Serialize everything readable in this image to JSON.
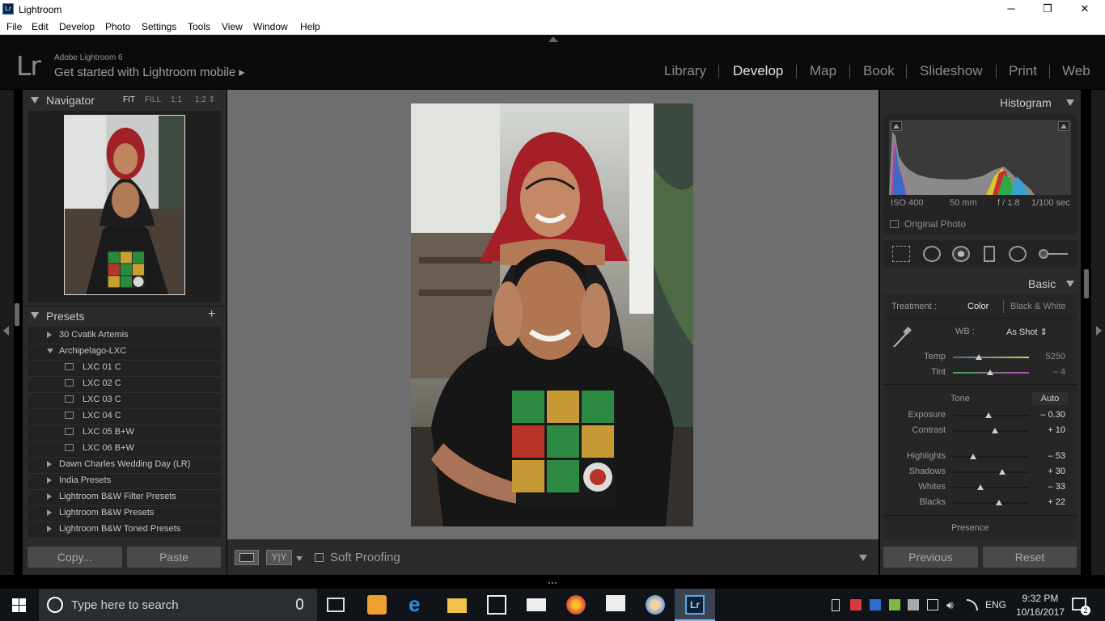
{
  "window": {
    "title": "Lightroom",
    "min": "─",
    "max": "❐",
    "close": "✕"
  },
  "menu": [
    "File",
    "Edit",
    "Develop",
    "Photo",
    "Settings",
    "Tools",
    "View",
    "Window",
    "Help"
  ],
  "header": {
    "logo": "Lr",
    "version": "Adobe Lightroom 6",
    "mobile": "Get started with Lightroom mobile ▸",
    "modules": [
      "Library",
      "Develop",
      "Map",
      "Book",
      "Slideshow",
      "Print",
      "Web"
    ],
    "active_module": "Develop"
  },
  "navigator": {
    "title": "Navigator",
    "zoom": [
      "FIT",
      "FILL",
      "1:1",
      "1:2 ⇕"
    ]
  },
  "presets": {
    "title": "Presets",
    "add": "+",
    "items": [
      {
        "label": "30 Cvatik Artemis",
        "type": "folder",
        "open": false
      },
      {
        "label": "Archipelago-LXC",
        "type": "folder",
        "open": true
      },
      {
        "label": "LXC 01 C",
        "type": "preset"
      },
      {
        "label": "LXC 02 C",
        "type": "preset"
      },
      {
        "label": "LXC 03 C",
        "type": "preset"
      },
      {
        "label": "LXC 04 C",
        "type": "preset"
      },
      {
        "label": "LXC 05 B+W",
        "type": "preset"
      },
      {
        "label": "LXC 06 B+W",
        "type": "preset"
      },
      {
        "label": "Dawn Charles Wedding Day (LR)",
        "type": "folder",
        "open": false
      },
      {
        "label": "India Presets",
        "type": "folder",
        "open": false
      },
      {
        "label": "Lightroom B&W Filter Presets",
        "type": "folder",
        "open": false
      },
      {
        "label": "Lightroom B&W Presets",
        "type": "folder",
        "open": false
      },
      {
        "label": "Lightroom B&W Toned Presets",
        "type": "folder",
        "open": false
      }
    ]
  },
  "left_buttons": {
    "copy": "Copy...",
    "paste": "Paste"
  },
  "toolbar": {
    "soft_proofing": "Soft Proofing",
    "compare": "Y|Y"
  },
  "histogram": {
    "title": "Histogram",
    "iso": "ISO 400",
    "focal": "50 mm",
    "aperture": "f / 1.8",
    "shutter": "1/100 sec",
    "original": "Original Photo"
  },
  "basic": {
    "title": "Basic",
    "treatment_label": "Treatment :",
    "color": "Color",
    "bw": "Black & White",
    "wb_label": "WB :",
    "wb_value": "As Shot ⇕",
    "tone_label": "Tone",
    "auto": "Auto",
    "presence": "Presence",
    "sliders": [
      {
        "label": "Temp",
        "value": "5250",
        "pos": 0.34
      },
      {
        "label": "Tint",
        "value": "– 4",
        "pos": 0.49
      },
      {
        "label": "Exposure",
        "value": "– 0.30",
        "pos": 0.47
      },
      {
        "label": "Contrast",
        "value": "+ 10",
        "pos": 0.55
      },
      {
        "label": "Highlights",
        "value": "– 53",
        "pos": 0.27
      },
      {
        "label": "Shadows",
        "value": "+ 30",
        "pos": 0.65
      },
      {
        "label": "Whites",
        "value": "– 33",
        "pos": 0.36
      },
      {
        "label": "Blacks",
        "value": "+ 22",
        "pos": 0.61
      }
    ]
  },
  "right_buttons": {
    "previous": "Previous",
    "reset": "Reset"
  },
  "taskbar": {
    "search_placeholder": "Type here to search",
    "lang": "ENG",
    "time": "9:32 PM",
    "date": "10/16/2017",
    "notif": "2"
  }
}
